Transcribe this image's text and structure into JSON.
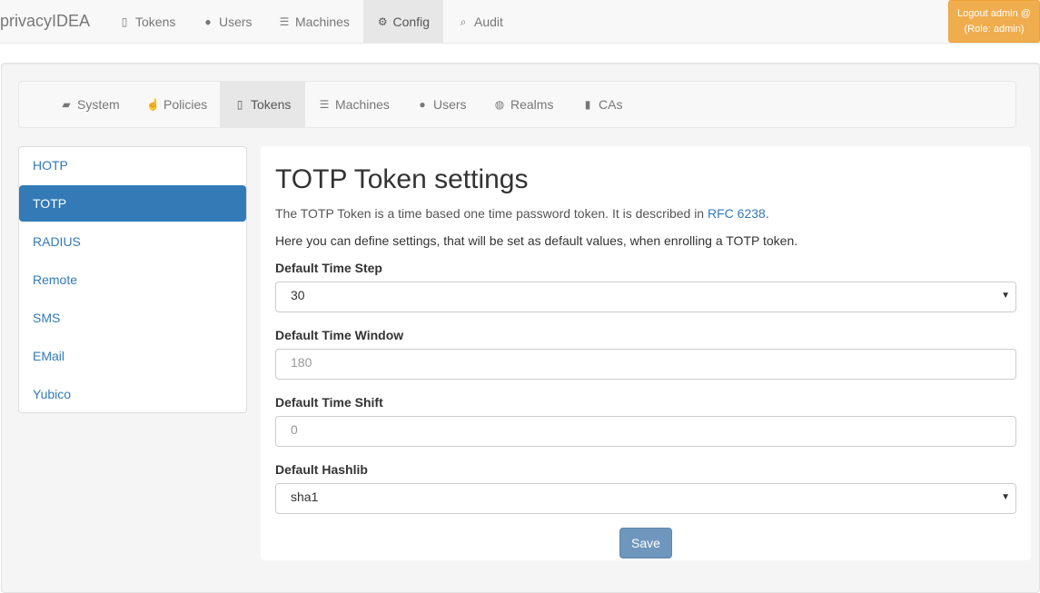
{
  "topnav": {
    "brand": "privacyIDEA",
    "items": [
      {
        "label": "Tokens",
        "icon": "mobile-icon"
      },
      {
        "label": "Users",
        "icon": "user-icon"
      },
      {
        "label": "Machines",
        "icon": "server-icon"
      },
      {
        "label": "Config",
        "icon": "gear-icon"
      },
      {
        "label": "Audit",
        "icon": "search-icon"
      }
    ],
    "active": "Config",
    "logout_line1": "Logout admin @",
    "logout_line2": "(Role: admin)"
  },
  "subnav": {
    "items": [
      {
        "label": "System",
        "icon": "briefcase-icon"
      },
      {
        "label": "Policies",
        "icon": "hand-icon"
      },
      {
        "label": "Tokens",
        "icon": "mobile-icon"
      },
      {
        "label": "Machines",
        "icon": "server-icon"
      },
      {
        "label": "Users",
        "icon": "user-icon"
      },
      {
        "label": "Realms",
        "icon": "globe-icon"
      },
      {
        "label": "CAs",
        "icon": "bookmark-icon"
      }
    ],
    "active": "Tokens"
  },
  "sidebar": {
    "items": [
      {
        "label": "HOTP"
      },
      {
        "label": "TOTP"
      },
      {
        "label": "RADIUS"
      },
      {
        "label": "Remote"
      },
      {
        "label": "SMS"
      },
      {
        "label": "EMail"
      },
      {
        "label": "Yubico"
      }
    ],
    "active": "TOTP"
  },
  "main": {
    "title": "TOTP Token settings",
    "desc_prefix": "The TOTP Token is a time based one time password token. It is described in ",
    "desc_link": "RFC 6238",
    "desc_suffix": ".",
    "desc2": "Here you can define settings, that will be set as default values, when enrolling a TOTP token.",
    "timestep_label": "Default Time Step",
    "timestep_value": "30",
    "timewindow_label": "Default Time Window",
    "timewindow_placeholder": "180",
    "timeshift_label": "Default Time Shift",
    "timeshift_placeholder": "0",
    "hashlib_label": "Default Hashlib",
    "hashlib_value": "sha1",
    "save_label": "Save"
  },
  "colors": {
    "accent": "#337ab7",
    "logout": "#f0ad4e",
    "save": "#6f96bd"
  }
}
